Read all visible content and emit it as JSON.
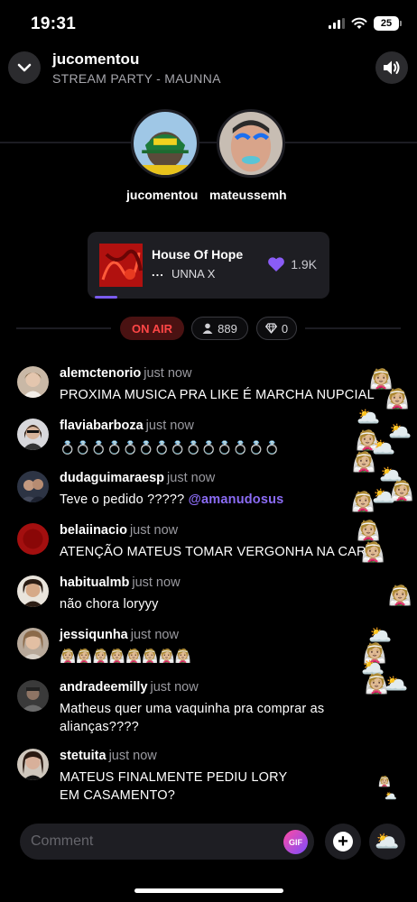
{
  "status": {
    "time": "19:31",
    "battery": "25"
  },
  "header": {
    "title": "jucomentou",
    "subtitle": "STREAM PARTY - MAUNNA"
  },
  "participants": [
    {
      "name": "jucomentou"
    },
    {
      "name": "mateussemh"
    }
  ],
  "now_playing": {
    "title": "House Of Hope",
    "dots": "...",
    "artist": "UNNA X",
    "likes": "1.9K",
    "progress": 0.1
  },
  "stream": {
    "on_air": "ON AIR",
    "viewers": "889",
    "gems": "0"
  },
  "comments": [
    {
      "user": "alemctenorio",
      "time": "just now",
      "text": "PROXIMA MUSICA PRA LIKE É MARCHA NUPCIAL"
    },
    {
      "user": "flaviabarboza",
      "time": "just now",
      "text": "💍💍💍💍💍💍💍💍💍💍💍💍💍💍"
    },
    {
      "user": "dudaguimaraesp",
      "time": "just now",
      "text": "Teve o pedido ????? ",
      "mention": "@amanudosus"
    },
    {
      "user": "belaiinacio",
      "time": "just now",
      "text": "ATENÇÃO MATEUS TOMAR VERGONHA NA CARA"
    },
    {
      "user": "habitualmb",
      "time": "just now",
      "text": "não chora loryyy"
    },
    {
      "user": "jessiqunha",
      "time": "just now",
      "text": "👰🏼👰🏼👰🏼👰🏼👰🏼👰🏼👰🏼👰🏼"
    },
    {
      "user": "andradeemilly",
      "time": "just now",
      "text": "Matheus quer uma vaquinha pra comprar as",
      "text2": "alianças????"
    },
    {
      "user": "stetuita",
      "time": "just now",
      "text": "MATEUS FINALMENTE PEDIU LORY",
      "text2": "EM CASAMENTO?"
    }
  ],
  "composer": {
    "placeholder": "Comment",
    "gif_label": "GIF"
  },
  "colors": {
    "accent": "#7b5cf0",
    "on_air": "#ff4646",
    "background": "#000000"
  },
  "icons": {
    "collapse": "chevron-down-icon",
    "sound": "speaker-icon",
    "like": "heart-icon",
    "viewers": "person-icon",
    "gems": "diamond-icon",
    "add": "plus-icon",
    "reaction": "cloud-sun-icon",
    "floating": [
      "bride-emoji",
      "cloud-sun-emoji"
    ]
  }
}
